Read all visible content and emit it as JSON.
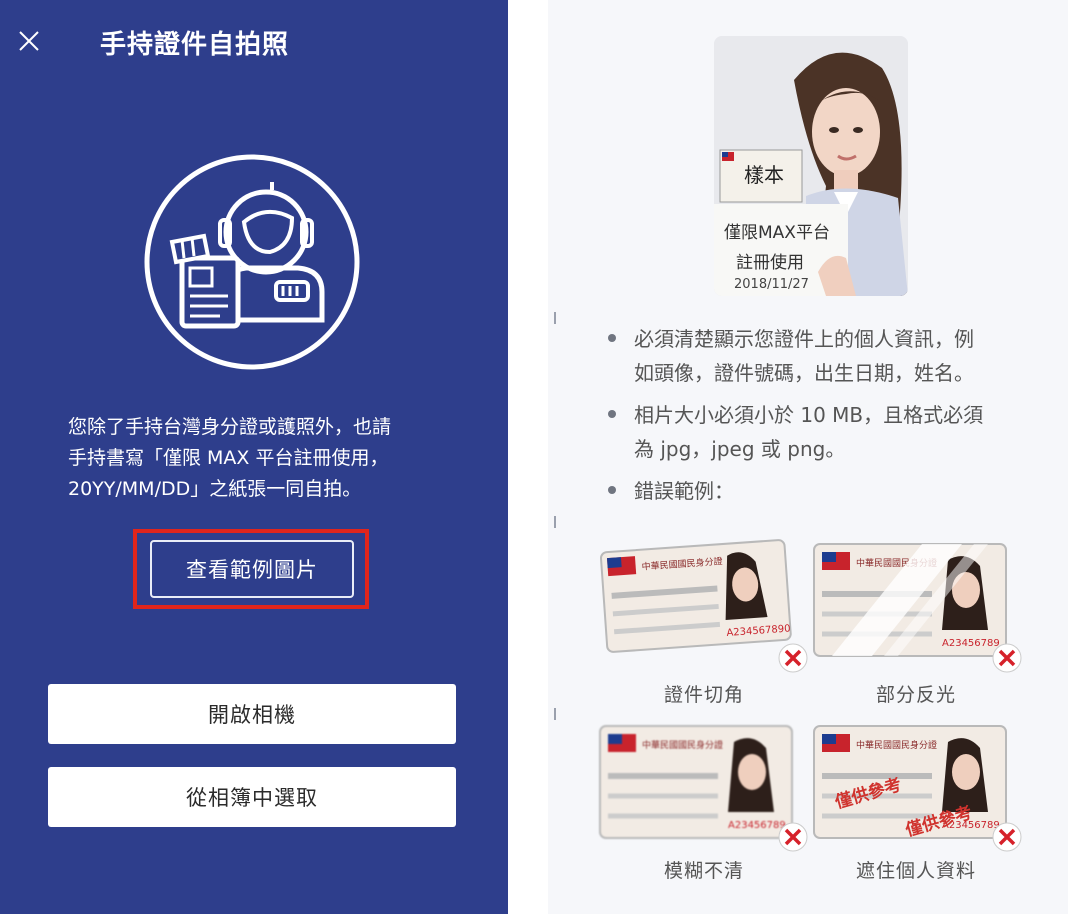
{
  "left": {
    "title": "手持證件自拍照",
    "description_lines": [
      "您除了手持台灣身分證或護照外，也請",
      "手持書寫「僅限 MAX 平台註冊使用，",
      "20YY/MM/DD」之紙張一同自拍。"
    ],
    "sample_button": "查看範例圖片",
    "camera_button": "開啟相機",
    "album_button": "從相簿中選取",
    "colors": {
      "background": "#2e3e8c",
      "highlight": "#e0251c"
    }
  },
  "right": {
    "sample_photo": {
      "sign_top": "樣本",
      "sign_lines": [
        "僅限MAX平台",
        "註冊使用",
        "2018/11/27"
      ]
    },
    "rules": [
      {
        "lines": [
          "必須清楚顯示您證件上的個人資訊，例",
          "如頭像，證件號碼，出生日期，姓名。"
        ]
      },
      {
        "lines": [
          "相片大小必須小於 10 MB，且格式必須",
          "為 jpg，jpeg 或 png。"
        ]
      },
      {
        "lines": [
          "錯誤範例："
        ]
      }
    ],
    "examples": [
      {
        "caption": "證件切角",
        "card_title": "中華民國國民身分證",
        "card_id": "A234567890"
      },
      {
        "caption": "部分反光",
        "card_title": "中華民國國民身分證",
        "card_id": "A23456789"
      },
      {
        "caption": "模糊不清",
        "card_title": "中華民國國民身分證",
        "card_id": "A23456789"
      },
      {
        "caption": "遮住個人資料",
        "card_title": "中華民國國民身分證",
        "card_id": "A23456789",
        "watermark": "僅供參考"
      }
    ]
  }
}
